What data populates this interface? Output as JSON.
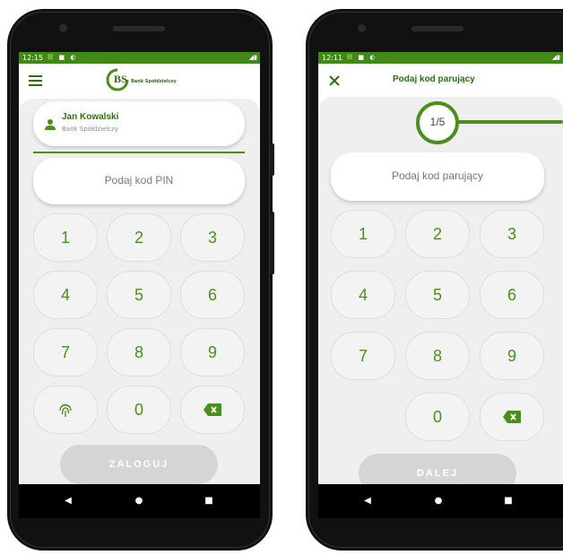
{
  "login_screen": {
    "status": {
      "time": "12:15",
      "icons": "☷ ■ ◐",
      "right_icons": "◢▮"
    },
    "header": {
      "menu_icon": "hamburger-icon",
      "logo_text": "BS",
      "logo_sub": "Bank Spółdzielczy"
    },
    "user": {
      "name": "Jan Kowalski",
      "bank": "Bank Spółdzielczy"
    },
    "pin_placeholder": "Podaj kod PIN",
    "keys": [
      "1",
      "2",
      "3",
      "4",
      "5",
      "6",
      "7",
      "8",
      "9",
      "0"
    ],
    "login_button": "ZALOGUJ",
    "nav": {
      "back": "◀",
      "home": "●",
      "recents": "■"
    }
  },
  "pairing_screen": {
    "status": {
      "time": "12:11",
      "icons": "☷ ■ ◐",
      "right_icons": "◢▮"
    },
    "header": {
      "close_icon": "close-icon",
      "title": "Podaj kod parujący"
    },
    "progress": {
      "step": "1/5",
      "fraction": 0.2
    },
    "code_placeholder": "Podaj kod parujący",
    "keys": [
      "1",
      "2",
      "3",
      "4",
      "5",
      "6",
      "7",
      "8",
      "9",
      "0"
    ],
    "next_button": "DALEJ",
    "nav": {
      "back": "◀",
      "home": "●",
      "recents": "■"
    }
  },
  "colors": {
    "brand_green": "#4a8f1c",
    "status_green": "#3f8a14",
    "disabled_button": "#d5d5d5"
  }
}
